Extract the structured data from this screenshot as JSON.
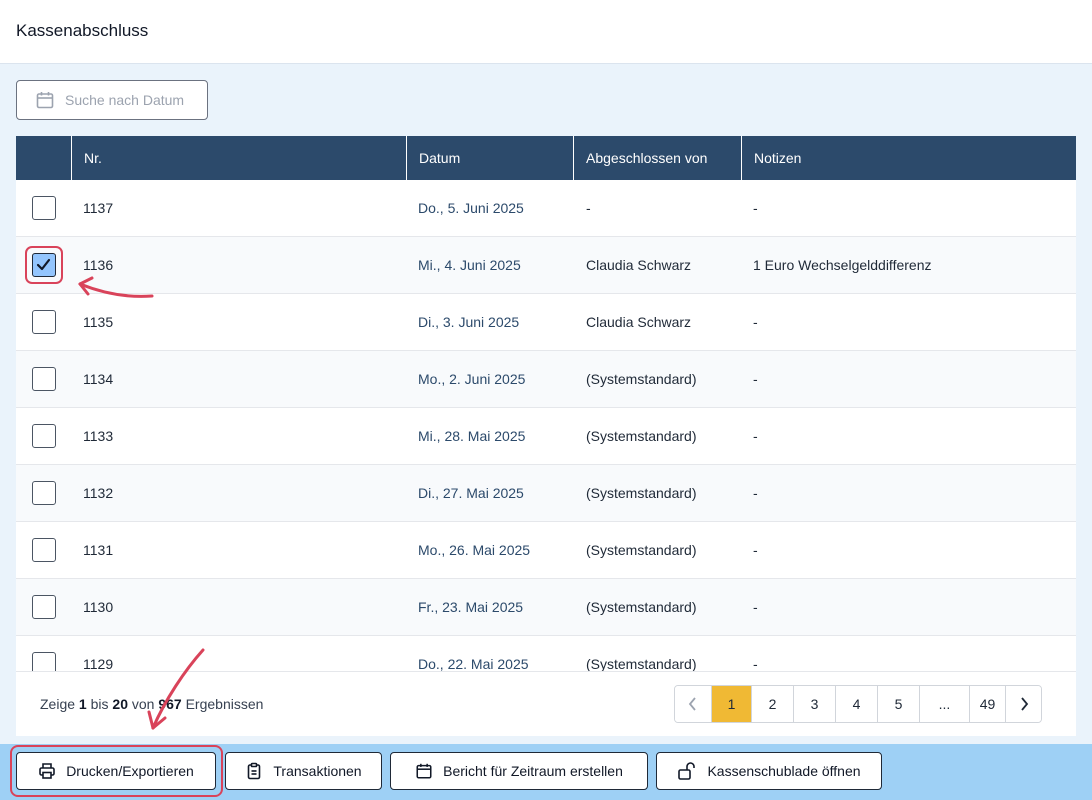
{
  "page": {
    "title": "Kassenabschluss"
  },
  "search": {
    "placeholder": "Suche nach Datum",
    "icon": "calendar-icon"
  },
  "table": {
    "headers": {
      "nr": "Nr.",
      "datum": "Datum",
      "abgeschlossen_von": "Abgeschlossen von",
      "notizen": "Notizen"
    },
    "rows": [
      {
        "nr": "1137",
        "datum": "Do., 5. Juni 2025",
        "abgeschlossen_von": "-",
        "notizen": "-",
        "checked": false
      },
      {
        "nr": "1136",
        "datum": "Mi., 4. Juni 2025",
        "abgeschlossen_von": "Claudia Schwarz",
        "notizen": "1 Euro Wechselgelddifferenz",
        "checked": true
      },
      {
        "nr": "1135",
        "datum": "Di., 3. Juni 2025",
        "abgeschlossen_von": "Claudia Schwarz",
        "notizen": "-",
        "checked": false
      },
      {
        "nr": "1134",
        "datum": "Mo., 2. Juni 2025",
        "abgeschlossen_von": "(Systemstandard)",
        "notizen": "-",
        "checked": false
      },
      {
        "nr": "1133",
        "datum": "Mi., 28. Mai 2025",
        "abgeschlossen_von": "(Systemstandard)",
        "notizen": "-",
        "checked": false
      },
      {
        "nr": "1132",
        "datum": "Di., 27. Mai 2025",
        "abgeschlossen_von": "(Systemstandard)",
        "notizen": "-",
        "checked": false
      },
      {
        "nr": "1131",
        "datum": "Mo., 26. Mai 2025",
        "abgeschlossen_von": "(Systemstandard)",
        "notizen": "-",
        "checked": false
      },
      {
        "nr": "1130",
        "datum": "Fr., 23. Mai 2025",
        "abgeschlossen_von": "(Systemstandard)",
        "notizen": "-",
        "checked": false
      },
      {
        "nr": "1129",
        "datum": "Do., 22. Mai 2025",
        "abgeschlossen_von": "(Systemstandard)",
        "notizen": "-",
        "checked": false
      }
    ]
  },
  "results": {
    "prefix": "Zeige",
    "from": "1",
    "mid1": "bis",
    "to": "20",
    "mid2": "von",
    "total": "967",
    "suffix": "Ergebnissen"
  },
  "pagination": {
    "prev_icon": "chevron-left-icon",
    "next_icon": "chevron-right-icon",
    "pages": [
      "1",
      "2",
      "3",
      "4",
      "5",
      "...",
      "49"
    ],
    "active": "1"
  },
  "toolbar": {
    "print_export": {
      "label": "Drucken/Exportieren",
      "icon": "printer-icon"
    },
    "transactions": {
      "label": "Transaktionen",
      "icon": "clipboard-icon"
    },
    "report_range": {
      "label": "Bericht für Zeitraum erstellen",
      "icon": "calendar-icon"
    },
    "open_drawer": {
      "label": "Kassenschublade öffnen",
      "icon": "unlock-icon"
    }
  },
  "colors": {
    "header_bg": "#2c4a6b",
    "toolbar_bg": "#9ed0f5",
    "active_page": "#f0b934",
    "highlight": "#d9435a",
    "checked": "#93c5fd"
  }
}
